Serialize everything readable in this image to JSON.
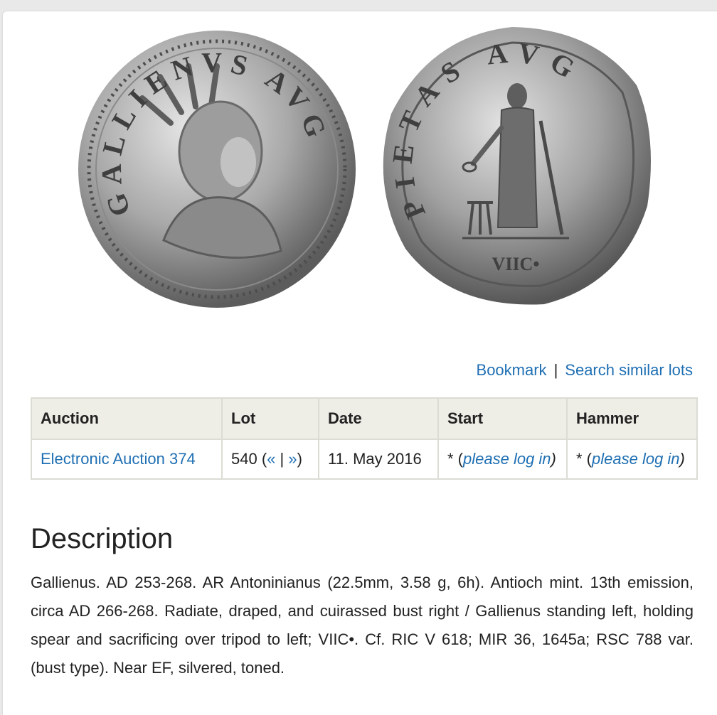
{
  "coin_images": {
    "obverse_legend": "GALLIENVS AVG",
    "reverse_legend": "PIETAS AVG",
    "reverse_mark": "VIIC•"
  },
  "links": {
    "bookmark": "Bookmark",
    "separator": "|",
    "search_similar": "Search similar lots"
  },
  "table": {
    "headers": [
      "Auction",
      "Lot",
      "Date",
      "Start",
      "Hammer"
    ],
    "row": {
      "auction": "Electronic Auction 374",
      "lot_number": "540 (",
      "lot_prev": "«",
      "lot_sep": " | ",
      "lot_next": "»",
      "lot_close": ")",
      "date": "11. May 2016",
      "start_prefix": "* (",
      "start_link": "please log in",
      "start_suffix": ")",
      "hammer_prefix": "* (",
      "hammer_link": "please log in",
      "hammer_suffix": ")"
    }
  },
  "description": {
    "title": "Description",
    "text": "Gallienus. AD 253-268. AR Antoninianus (22.5mm, 3.58 g, 6h). Antioch mint. 13th emission, circa AD 266-268. Radiate, draped, and cuirassed bust right / Gallienus standing left, holding spear and sacrificing over tripod to left; VIIC•. Cf. RIC V 618; MIR 36, 1645a; RSC 788 var. (bust type). Near EF, silvered, toned."
  },
  "colors": {
    "link": "#1f6fb3",
    "header_bg": "#eeede6",
    "border": "#dcdcd5"
  }
}
